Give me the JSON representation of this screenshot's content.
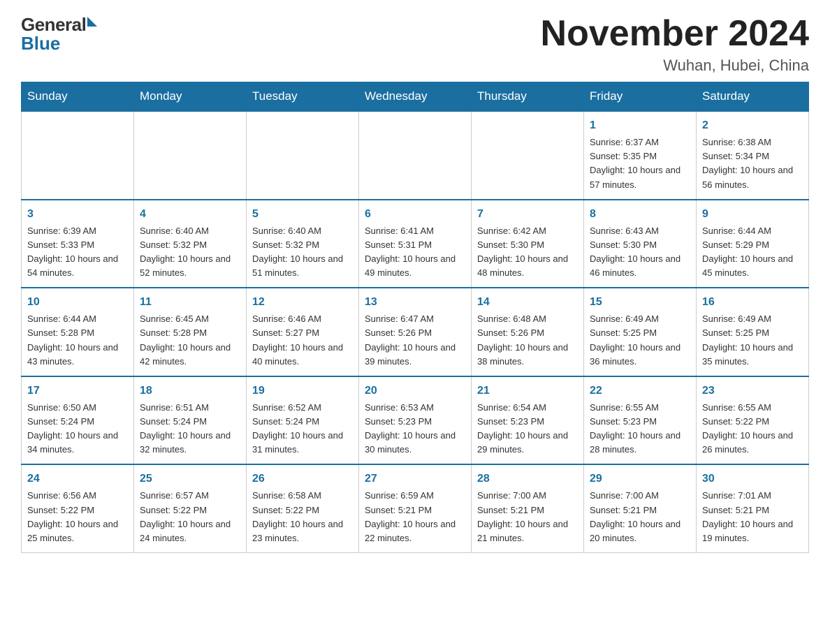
{
  "header": {
    "title": "November 2024",
    "subtitle": "Wuhan, Hubei, China",
    "logo_general": "General",
    "logo_blue": "Blue"
  },
  "days_of_week": [
    "Sunday",
    "Monday",
    "Tuesday",
    "Wednesday",
    "Thursday",
    "Friday",
    "Saturday"
  ],
  "weeks": [
    [
      {
        "day": "",
        "info": ""
      },
      {
        "day": "",
        "info": ""
      },
      {
        "day": "",
        "info": ""
      },
      {
        "day": "",
        "info": ""
      },
      {
        "day": "",
        "info": ""
      },
      {
        "day": "1",
        "info": "Sunrise: 6:37 AM\nSunset: 5:35 PM\nDaylight: 10 hours and 57 minutes."
      },
      {
        "day": "2",
        "info": "Sunrise: 6:38 AM\nSunset: 5:34 PM\nDaylight: 10 hours and 56 minutes."
      }
    ],
    [
      {
        "day": "3",
        "info": "Sunrise: 6:39 AM\nSunset: 5:33 PM\nDaylight: 10 hours and 54 minutes."
      },
      {
        "day": "4",
        "info": "Sunrise: 6:40 AM\nSunset: 5:32 PM\nDaylight: 10 hours and 52 minutes."
      },
      {
        "day": "5",
        "info": "Sunrise: 6:40 AM\nSunset: 5:32 PM\nDaylight: 10 hours and 51 minutes."
      },
      {
        "day": "6",
        "info": "Sunrise: 6:41 AM\nSunset: 5:31 PM\nDaylight: 10 hours and 49 minutes."
      },
      {
        "day": "7",
        "info": "Sunrise: 6:42 AM\nSunset: 5:30 PM\nDaylight: 10 hours and 48 minutes."
      },
      {
        "day": "8",
        "info": "Sunrise: 6:43 AM\nSunset: 5:30 PM\nDaylight: 10 hours and 46 minutes."
      },
      {
        "day": "9",
        "info": "Sunrise: 6:44 AM\nSunset: 5:29 PM\nDaylight: 10 hours and 45 minutes."
      }
    ],
    [
      {
        "day": "10",
        "info": "Sunrise: 6:44 AM\nSunset: 5:28 PM\nDaylight: 10 hours and 43 minutes."
      },
      {
        "day": "11",
        "info": "Sunrise: 6:45 AM\nSunset: 5:28 PM\nDaylight: 10 hours and 42 minutes."
      },
      {
        "day": "12",
        "info": "Sunrise: 6:46 AM\nSunset: 5:27 PM\nDaylight: 10 hours and 40 minutes."
      },
      {
        "day": "13",
        "info": "Sunrise: 6:47 AM\nSunset: 5:26 PM\nDaylight: 10 hours and 39 minutes."
      },
      {
        "day": "14",
        "info": "Sunrise: 6:48 AM\nSunset: 5:26 PM\nDaylight: 10 hours and 38 minutes."
      },
      {
        "day": "15",
        "info": "Sunrise: 6:49 AM\nSunset: 5:25 PM\nDaylight: 10 hours and 36 minutes."
      },
      {
        "day": "16",
        "info": "Sunrise: 6:49 AM\nSunset: 5:25 PM\nDaylight: 10 hours and 35 minutes."
      }
    ],
    [
      {
        "day": "17",
        "info": "Sunrise: 6:50 AM\nSunset: 5:24 PM\nDaylight: 10 hours and 34 minutes."
      },
      {
        "day": "18",
        "info": "Sunrise: 6:51 AM\nSunset: 5:24 PM\nDaylight: 10 hours and 32 minutes."
      },
      {
        "day": "19",
        "info": "Sunrise: 6:52 AM\nSunset: 5:24 PM\nDaylight: 10 hours and 31 minutes."
      },
      {
        "day": "20",
        "info": "Sunrise: 6:53 AM\nSunset: 5:23 PM\nDaylight: 10 hours and 30 minutes."
      },
      {
        "day": "21",
        "info": "Sunrise: 6:54 AM\nSunset: 5:23 PM\nDaylight: 10 hours and 29 minutes."
      },
      {
        "day": "22",
        "info": "Sunrise: 6:55 AM\nSunset: 5:23 PM\nDaylight: 10 hours and 28 minutes."
      },
      {
        "day": "23",
        "info": "Sunrise: 6:55 AM\nSunset: 5:22 PM\nDaylight: 10 hours and 26 minutes."
      }
    ],
    [
      {
        "day": "24",
        "info": "Sunrise: 6:56 AM\nSunset: 5:22 PM\nDaylight: 10 hours and 25 minutes."
      },
      {
        "day": "25",
        "info": "Sunrise: 6:57 AM\nSunset: 5:22 PM\nDaylight: 10 hours and 24 minutes."
      },
      {
        "day": "26",
        "info": "Sunrise: 6:58 AM\nSunset: 5:22 PM\nDaylight: 10 hours and 23 minutes."
      },
      {
        "day": "27",
        "info": "Sunrise: 6:59 AM\nSunset: 5:21 PM\nDaylight: 10 hours and 22 minutes."
      },
      {
        "day": "28",
        "info": "Sunrise: 7:00 AM\nSunset: 5:21 PM\nDaylight: 10 hours and 21 minutes."
      },
      {
        "day": "29",
        "info": "Sunrise: 7:00 AM\nSunset: 5:21 PM\nDaylight: 10 hours and 20 minutes."
      },
      {
        "day": "30",
        "info": "Sunrise: 7:01 AM\nSunset: 5:21 PM\nDaylight: 10 hours and 19 minutes."
      }
    ]
  ]
}
